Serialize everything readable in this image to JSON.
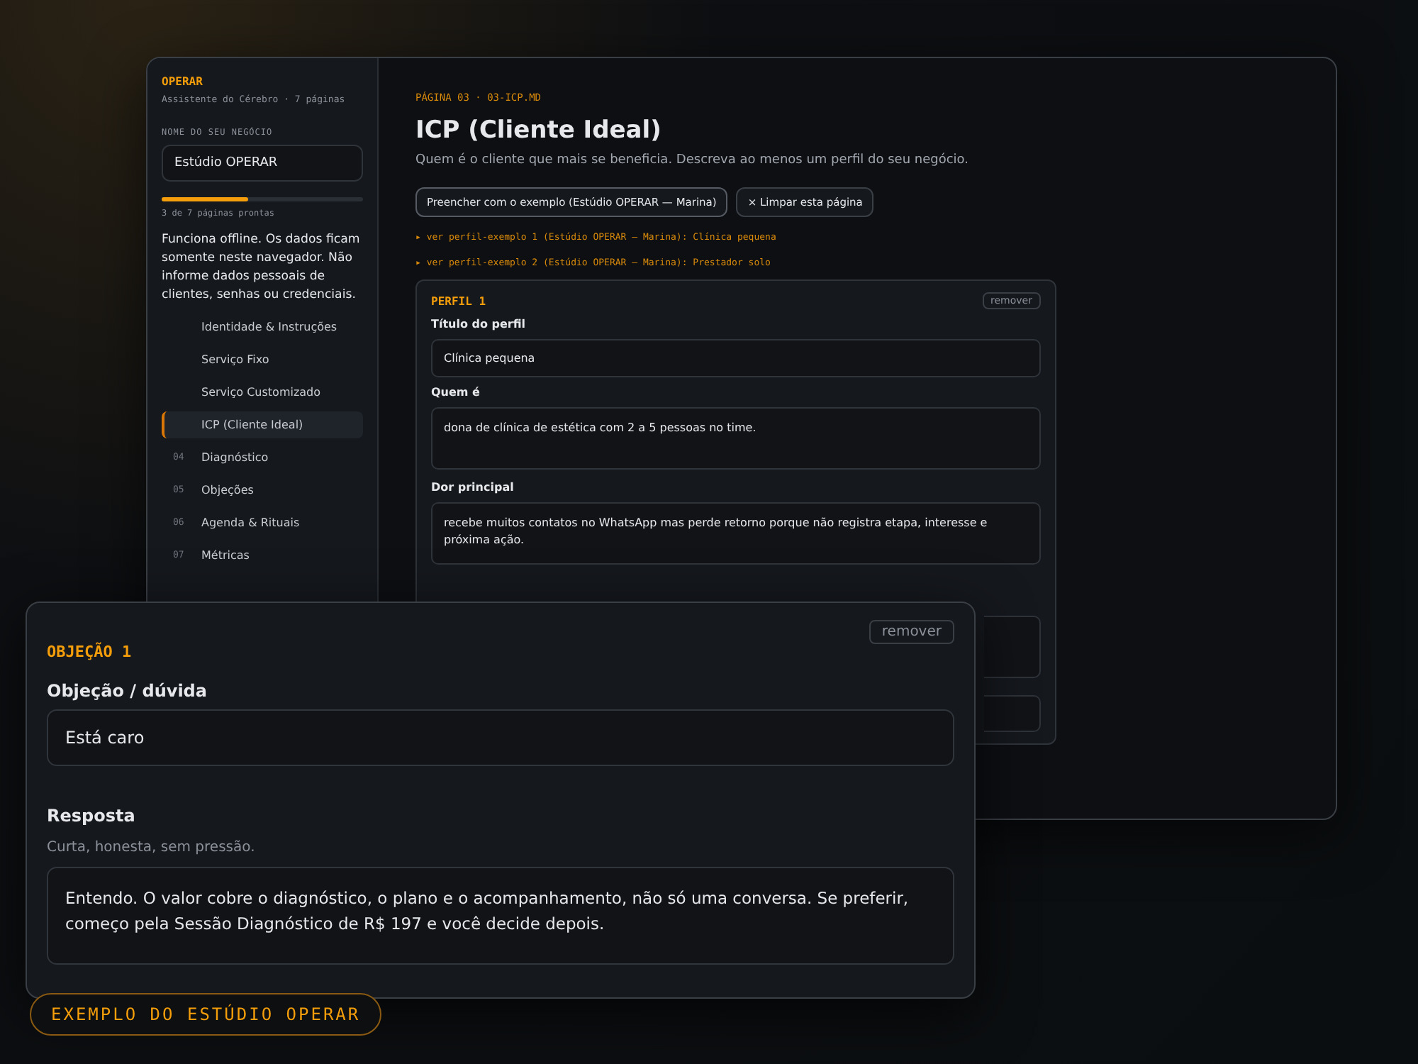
{
  "sidebar": {
    "brand": "OPERAR",
    "subtitle": "Assistente do Cérebro · 7 páginas",
    "business_label": "NOME DO SEU NEGÓCIO",
    "business_value": "Estúdio OPERAR",
    "progress": {
      "level": 0.43,
      "caption": "3 de 7 páginas prontas"
    },
    "notice": "Funciona offline. Os dados ficam somente neste navegador. Não informe dados pessoais de clientes, senhas ou credenciais.",
    "items": [
      {
        "label": "Identidade & Instruções",
        "selected": false
      },
      {
        "label": "Serviço Fixo",
        "selected": false
      },
      {
        "label": "Serviço Customizado",
        "selected": false
      },
      {
        "label": "ICP (Cliente Ideal)",
        "selected": true
      },
      {
        "number": "04",
        "label": "Diagnóstico",
        "selected": false
      },
      {
        "number": "05",
        "label": "Objeções",
        "selected": false
      },
      {
        "number": "06",
        "label": "Agenda & Rituais",
        "selected": false
      },
      {
        "number": "07",
        "label": "Métricas",
        "selected": false
      }
    ]
  },
  "main": {
    "eyebrow": "PÁGINA 03 · 03-ICP.MD",
    "title": "ICP (Cliente Ideal)",
    "description": "Quem é o cliente que mais se beneficia. Descreva ao menos um perfil do seu negócio.",
    "buttons": [
      "Preencher com o exemplo (Estúdio OPERAR — Marina)",
      "× Limpar esta página"
    ],
    "examples": [
      "▸ ver perfil-exemplo 1 (Estúdio OPERAR — Marina): Clínica pequena",
      "▸ ver perfil-exemplo 2 (Estúdio OPERAR — Marina): Prestador solo"
    ],
    "profile": {
      "heading": "PERFIL 1",
      "remove": "remover",
      "fields": [
        {
          "kind": "input",
          "label": "Título do perfil",
          "value": "Clínica pequena"
        },
        {
          "kind": "textarea",
          "label": "Quem é",
          "value": "dona de clínica de estética com 2 a 5 pessoas no time."
        },
        {
          "kind": "textarea",
          "label": "Dor principal",
          "value": "recebe muitos contatos no WhatsApp mas perde retorno porque não registra etapa, interesse e próxima ação."
        }
      ]
    }
  },
  "objection": {
    "heading": "OBJEÇÃO 1",
    "remove": "remover",
    "fields": [
      {
        "kind": "input",
        "label": "Objeção / dúvida",
        "value": "Está caro"
      },
      {
        "kind": "textarea",
        "label": "Resposta",
        "hint": "Curta, honesta, sem pressão.",
        "value": "Entendo. O valor cobre o diagnóstico, o plano e o acompanhamento, não só uma conversa. Se preferir, começo pela Sessão Diagnóstico de R$ 197 e você decide depois."
      }
    ]
  },
  "badge": "EXEMPLO DO ESTÚDIO OPERAR"
}
